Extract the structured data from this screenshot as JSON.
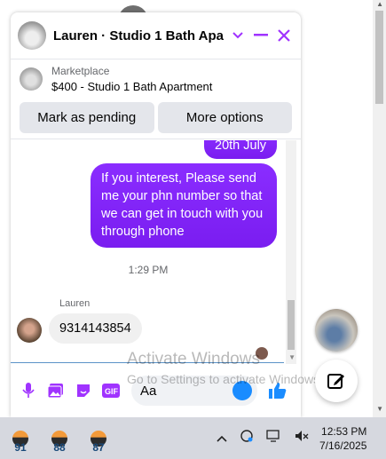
{
  "header": {
    "title": "Lauren · Studio 1 Bath Apa..."
  },
  "listing": {
    "kind": "Marketplace",
    "name": "$400 - Studio 1 Bath Apartment",
    "buttons": [
      "Mark as pending",
      "More options"
    ]
  },
  "thread": {
    "partial_bubble": "20th July",
    "outgoing_message": "If you interest, Please send me your phn number so that we can get in touch with you through phone",
    "timestamp": "1:29 PM",
    "sender_name": "Lauren",
    "incoming_message": "9314143854"
  },
  "composer": {
    "placeholder": "Aa"
  },
  "watermark": {
    "line1": "Activate Windows",
    "line2": "Go to Settings to activate Windows."
  },
  "taskbar": {
    "apps": [
      {
        "label": "91"
      },
      {
        "label": "88"
      },
      {
        "label": "87"
      }
    ],
    "time": "12:53 PM",
    "date": "7/16/2025"
  },
  "colors": {
    "accent": "#a033ff",
    "bubble": "#8a2dff"
  }
}
